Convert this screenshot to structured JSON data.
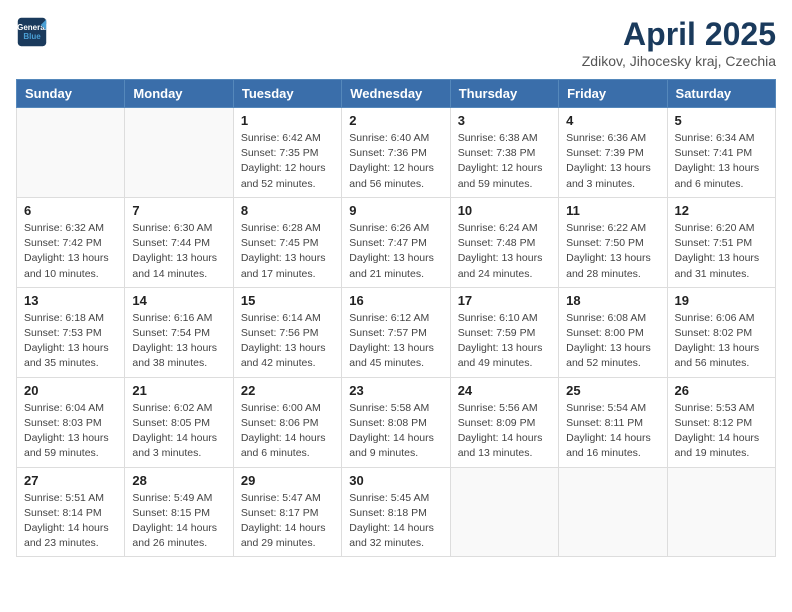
{
  "logo": {
    "line1": "General",
    "line2": "Blue"
  },
  "title": "April 2025",
  "subtitle": "Zdikov, Jihocesky kraj, Czechia",
  "weekdays": [
    "Sunday",
    "Monday",
    "Tuesday",
    "Wednesday",
    "Thursday",
    "Friday",
    "Saturday"
  ],
  "weeks": [
    [
      {
        "day": "",
        "detail": ""
      },
      {
        "day": "",
        "detail": ""
      },
      {
        "day": "1",
        "detail": "Sunrise: 6:42 AM\nSunset: 7:35 PM\nDaylight: 12 hours\nand 52 minutes."
      },
      {
        "day": "2",
        "detail": "Sunrise: 6:40 AM\nSunset: 7:36 PM\nDaylight: 12 hours\nand 56 minutes."
      },
      {
        "day": "3",
        "detail": "Sunrise: 6:38 AM\nSunset: 7:38 PM\nDaylight: 12 hours\nand 59 minutes."
      },
      {
        "day": "4",
        "detail": "Sunrise: 6:36 AM\nSunset: 7:39 PM\nDaylight: 13 hours\nand 3 minutes."
      },
      {
        "day": "5",
        "detail": "Sunrise: 6:34 AM\nSunset: 7:41 PM\nDaylight: 13 hours\nand 6 minutes."
      }
    ],
    [
      {
        "day": "6",
        "detail": "Sunrise: 6:32 AM\nSunset: 7:42 PM\nDaylight: 13 hours\nand 10 minutes."
      },
      {
        "day": "7",
        "detail": "Sunrise: 6:30 AM\nSunset: 7:44 PM\nDaylight: 13 hours\nand 14 minutes."
      },
      {
        "day": "8",
        "detail": "Sunrise: 6:28 AM\nSunset: 7:45 PM\nDaylight: 13 hours\nand 17 minutes."
      },
      {
        "day": "9",
        "detail": "Sunrise: 6:26 AM\nSunset: 7:47 PM\nDaylight: 13 hours\nand 21 minutes."
      },
      {
        "day": "10",
        "detail": "Sunrise: 6:24 AM\nSunset: 7:48 PM\nDaylight: 13 hours\nand 24 minutes."
      },
      {
        "day": "11",
        "detail": "Sunrise: 6:22 AM\nSunset: 7:50 PM\nDaylight: 13 hours\nand 28 minutes."
      },
      {
        "day": "12",
        "detail": "Sunrise: 6:20 AM\nSunset: 7:51 PM\nDaylight: 13 hours\nand 31 minutes."
      }
    ],
    [
      {
        "day": "13",
        "detail": "Sunrise: 6:18 AM\nSunset: 7:53 PM\nDaylight: 13 hours\nand 35 minutes."
      },
      {
        "day": "14",
        "detail": "Sunrise: 6:16 AM\nSunset: 7:54 PM\nDaylight: 13 hours\nand 38 minutes."
      },
      {
        "day": "15",
        "detail": "Sunrise: 6:14 AM\nSunset: 7:56 PM\nDaylight: 13 hours\nand 42 minutes."
      },
      {
        "day": "16",
        "detail": "Sunrise: 6:12 AM\nSunset: 7:57 PM\nDaylight: 13 hours\nand 45 minutes."
      },
      {
        "day": "17",
        "detail": "Sunrise: 6:10 AM\nSunset: 7:59 PM\nDaylight: 13 hours\nand 49 minutes."
      },
      {
        "day": "18",
        "detail": "Sunrise: 6:08 AM\nSunset: 8:00 PM\nDaylight: 13 hours\nand 52 minutes."
      },
      {
        "day": "19",
        "detail": "Sunrise: 6:06 AM\nSunset: 8:02 PM\nDaylight: 13 hours\nand 56 minutes."
      }
    ],
    [
      {
        "day": "20",
        "detail": "Sunrise: 6:04 AM\nSunset: 8:03 PM\nDaylight: 13 hours\nand 59 minutes."
      },
      {
        "day": "21",
        "detail": "Sunrise: 6:02 AM\nSunset: 8:05 PM\nDaylight: 14 hours\nand 3 minutes."
      },
      {
        "day": "22",
        "detail": "Sunrise: 6:00 AM\nSunset: 8:06 PM\nDaylight: 14 hours\nand 6 minutes."
      },
      {
        "day": "23",
        "detail": "Sunrise: 5:58 AM\nSunset: 8:08 PM\nDaylight: 14 hours\nand 9 minutes."
      },
      {
        "day": "24",
        "detail": "Sunrise: 5:56 AM\nSunset: 8:09 PM\nDaylight: 14 hours\nand 13 minutes."
      },
      {
        "day": "25",
        "detail": "Sunrise: 5:54 AM\nSunset: 8:11 PM\nDaylight: 14 hours\nand 16 minutes."
      },
      {
        "day": "26",
        "detail": "Sunrise: 5:53 AM\nSunset: 8:12 PM\nDaylight: 14 hours\nand 19 minutes."
      }
    ],
    [
      {
        "day": "27",
        "detail": "Sunrise: 5:51 AM\nSunset: 8:14 PM\nDaylight: 14 hours\nand 23 minutes."
      },
      {
        "day": "28",
        "detail": "Sunrise: 5:49 AM\nSunset: 8:15 PM\nDaylight: 14 hours\nand 26 minutes."
      },
      {
        "day": "29",
        "detail": "Sunrise: 5:47 AM\nSunset: 8:17 PM\nDaylight: 14 hours\nand 29 minutes."
      },
      {
        "day": "30",
        "detail": "Sunrise: 5:45 AM\nSunset: 8:18 PM\nDaylight: 14 hours\nand 32 minutes."
      },
      {
        "day": "",
        "detail": ""
      },
      {
        "day": "",
        "detail": ""
      },
      {
        "day": "",
        "detail": ""
      }
    ]
  ]
}
